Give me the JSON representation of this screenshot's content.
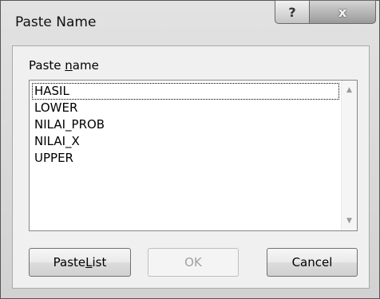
{
  "window": {
    "title": "Paste Name",
    "help_glyph": "?",
    "close_glyph": "x"
  },
  "label": {
    "prefix": "Paste ",
    "mnemonic": "n",
    "suffix": "ame"
  },
  "list": {
    "items": [
      "HASIL",
      "LOWER",
      "NILAI_PROB",
      "NILAI_X",
      "UPPER"
    ],
    "focused_index": 0
  },
  "scroll": {
    "up_glyph": "▲",
    "down_glyph": "▼"
  },
  "buttons": {
    "paste_list_prefix": "Paste ",
    "paste_list_mnemonic": "L",
    "paste_list_suffix": "ist",
    "ok": "OK",
    "cancel": "Cancel"
  }
}
